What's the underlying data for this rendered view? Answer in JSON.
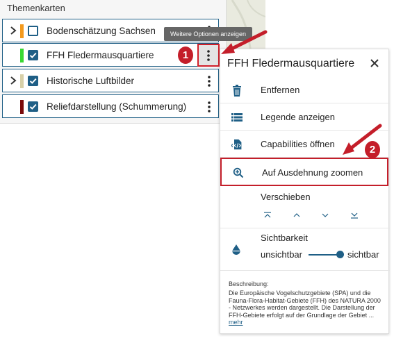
{
  "panel": {
    "title": "Themenkarten",
    "layers": [
      {
        "label": "Bodenschätzung Sachsen",
        "color": "#f39a1e",
        "checked": false,
        "expandable": true
      },
      {
        "label": "FFH Fledermausquartiere",
        "color": "#39d833",
        "checked": true,
        "expandable": false
      },
      {
        "label": "Historische Luftbilder",
        "color": "#d8d0a8",
        "checked": true,
        "expandable": true
      },
      {
        "label": "Reliefdarstellung (Schummerung)",
        "color": "#7a0a0a",
        "checked": true,
        "expandable": false
      }
    ]
  },
  "tooltip": "Weitere Optionen anzeigen",
  "badges": [
    "1",
    "2"
  ],
  "options": {
    "title": "FFH Fledermausquartiere",
    "items": [
      {
        "label": "Entfernen",
        "icon": "trash-icon"
      },
      {
        "label": "Legende anzeigen",
        "icon": "list-icon"
      },
      {
        "label": "Capabilities öffnen",
        "icon": "code-file-icon"
      },
      {
        "label": "Auf Ausdehnung zoomen",
        "icon": "zoom-in-icon"
      }
    ],
    "move_label": "Verschieben",
    "visibility": {
      "label": "Sichtbarkeit",
      "left": "unsichtbar",
      "right": "sichtbar",
      "value": 1
    },
    "description": {
      "title": "Beschreibung:",
      "text": "Die Europäische Vogelschutzgebiete (SPA) und die Fauna-Flora-Habitat-Gebiete (FFH) des NATURA 2000 - Netzwerkes werden dargestellt. Die Darstellung der FFH-Gebiete erfolgt auf der Grundlage der Gebiet ...",
      "more": "mehr"
    }
  },
  "colors": {
    "accent": "#1f5f86",
    "highlight": "#c41e2a"
  }
}
